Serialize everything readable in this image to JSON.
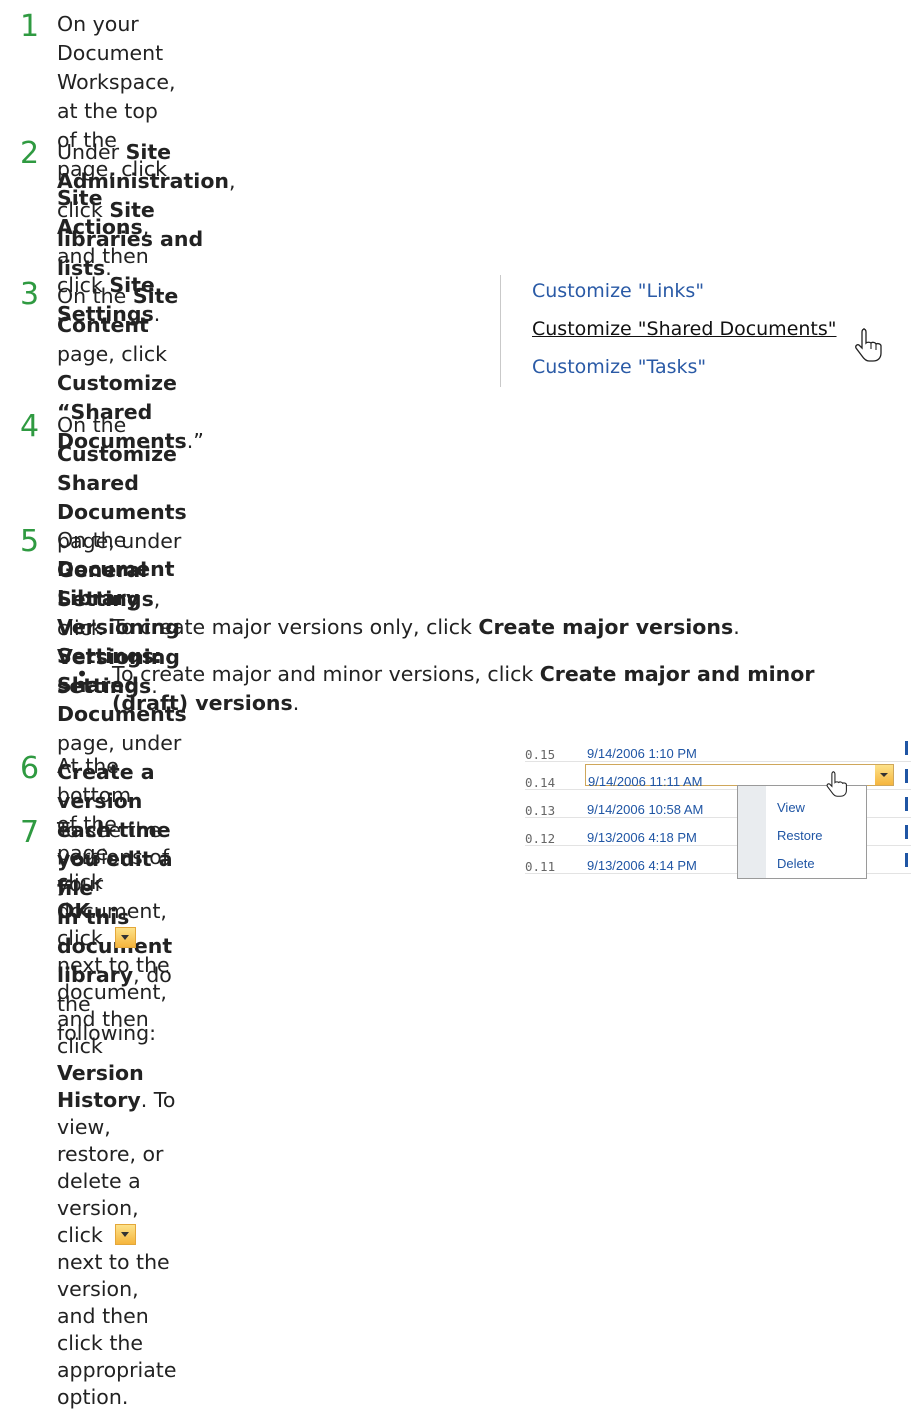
{
  "steps": [
    {
      "num": "1",
      "parts": [
        [
          "On your Document Workspace, at the top of the page, click ",
          "n"
        ],
        [
          "Site",
          "b"
        ],
        [
          "\nActions",
          "b"
        ],
        [
          ", and then click ",
          "n"
        ],
        [
          "Site Settings",
          "b"
        ],
        [
          ".",
          "n"
        ]
      ]
    },
    {
      "num": "2",
      "parts": [
        [
          "Under ",
          "n"
        ],
        [
          "Site Administration",
          "b"
        ],
        [
          ", click ",
          "n"
        ],
        [
          "Site libraries and lists",
          "b"
        ],
        [
          ".",
          "n"
        ]
      ]
    },
    {
      "num": "3",
      "parts": [
        [
          "On the ",
          "n"
        ],
        [
          "Site Content",
          "b"
        ],
        [
          " page, click",
          "n"
        ],
        [
          "\nCustomize “Shared Documents",
          "b"
        ],
        [
          ".”",
          "n"
        ]
      ]
    },
    {
      "num": "4",
      "parts": [
        [
          "On the ",
          "n"
        ],
        [
          "Customize Shared Documents",
          "b"
        ],
        [
          " page, under ",
          "n"
        ],
        [
          "General",
          "b"
        ],
        [
          "\nSettings",
          "b"
        ],
        [
          ", click ",
          "n"
        ],
        [
          "Versioning settings",
          "b"
        ],
        [
          ".",
          "n"
        ]
      ]
    },
    {
      "num": "5",
      "parts": [
        [
          "On the ",
          "n"
        ],
        [
          "Document Library Versioning Settings: Shared",
          "b"
        ],
        [
          "\nDocuments",
          "b"
        ],
        [
          " page, under ",
          "n"
        ],
        [
          "Create a version each time you edit a file",
          "b"
        ],
        [
          "\nin this document library",
          "b"
        ],
        [
          ", do the following:",
          "n"
        ]
      ]
    },
    {
      "num": "6",
      "parts": [
        [
          "At the bottom of the page, click ",
          "n"
        ],
        [
          "OK",
          "b"
        ],
        [
          ".",
          "n"
        ]
      ]
    },
    {
      "num": "7",
      "parts": [
        [
          "To see the versions of your",
          "n"
        ],
        [
          "\ndocument, click ",
          "n"
        ],
        [
          "[drop]",
          "d"
        ],
        [
          " next to the",
          "n"
        ],
        [
          "\ndocument, and then click ",
          "n"
        ],
        [
          "Version",
          "b"
        ],
        [
          "\nHistory",
          "b"
        ],
        [
          ". To view, restore, or delete a",
          "n"
        ],
        [
          "\nversion, click ",
          "n"
        ],
        [
          "[drop]",
          "d"
        ],
        [
          " next to the version,",
          "n"
        ],
        [
          "\nand then click the appropriate option.",
          "n"
        ]
      ]
    }
  ],
  "bullets": [
    {
      "parts": [
        [
          "To create major versions only, click ",
          "n"
        ],
        [
          "Create major versions",
          "b"
        ],
        [
          ".",
          "n"
        ]
      ]
    },
    {
      "parts": [
        [
          "To create major and minor versions, click ",
          "n"
        ],
        [
          "Create major and minor",
          "b"
        ],
        [
          "\n(draft) versions",
          "b"
        ],
        [
          ".",
          "n"
        ]
      ]
    }
  ],
  "bullet_char": "•",
  "links_panel": {
    "links": [
      "Customize \"Links\"",
      "Customize \"Shared Documents\"",
      "Customize \"Tasks\""
    ],
    "hovered_index": 1
  },
  "versions": {
    "rows": [
      {
        "num": "0.15",
        "date": "9/14/2006 1:10 PM"
      },
      {
        "num": "0.14",
        "date": "9/14/2006 11:11 AM"
      },
      {
        "num": "0.13",
        "date": "9/14/2006 10:58 AM"
      },
      {
        "num": "0.12",
        "date": "9/13/2006 4:18 PM"
      },
      {
        "num": "0.11",
        "date": "9/13/2006 4:14 PM"
      }
    ],
    "selected_index": 1,
    "menu": [
      "View",
      "Restore",
      "Delete"
    ]
  },
  "colors": {
    "step_number": "#2f9a41",
    "link": "#2a5aa6"
  },
  "icons": {
    "cursor": "hand-pointer-icon",
    "dropdown": "dropdown-arrow-icon"
  }
}
